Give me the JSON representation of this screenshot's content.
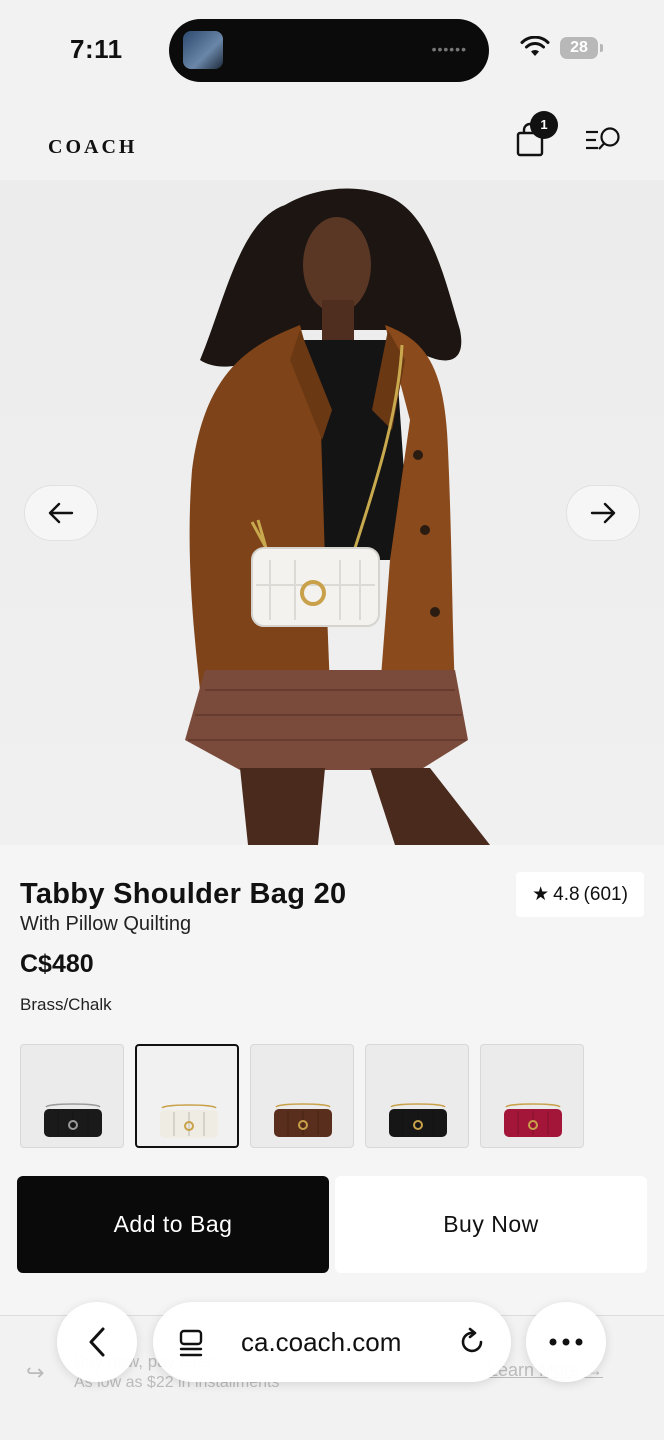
{
  "status_bar": {
    "time": "7:11",
    "battery": "28"
  },
  "header": {
    "brand": "COACH",
    "cart_count": "1"
  },
  "product": {
    "title": "Tabby Shoulder Bag 20",
    "subtitle": "With Pillow Quilting",
    "price": "C$480",
    "selected_color": "Brass/Chalk",
    "rating_value": "4.8",
    "rating_count": "(601)"
  },
  "swatches": [
    {
      "color": "#1a1a1a",
      "hardware": "#9a9a9a"
    },
    {
      "color": "#efece4",
      "hardware": "#c9a14a",
      "selected": true
    },
    {
      "color": "#5a2e1c",
      "hardware": "#c9a14a"
    },
    {
      "color": "#161616",
      "hardware": "#c9a14a"
    },
    {
      "color": "#a3163a",
      "hardware": "#c9a14a"
    }
  ],
  "actions": {
    "add_to_bag": "Add to Bag",
    "buy_now": "Buy Now"
  },
  "installments": {
    "title": "Buy now, pay later",
    "subtitle": "As low as $22 in installments",
    "link": "Learn More"
  },
  "browser": {
    "url": "ca.coach.com"
  },
  "icons": {
    "back": "chevron-left-icon",
    "tabs": "tabs-icon",
    "reload": "reload-icon",
    "more": "more-icon",
    "bag": "shopping-bag-icon",
    "menu": "menu-search-icon"
  }
}
